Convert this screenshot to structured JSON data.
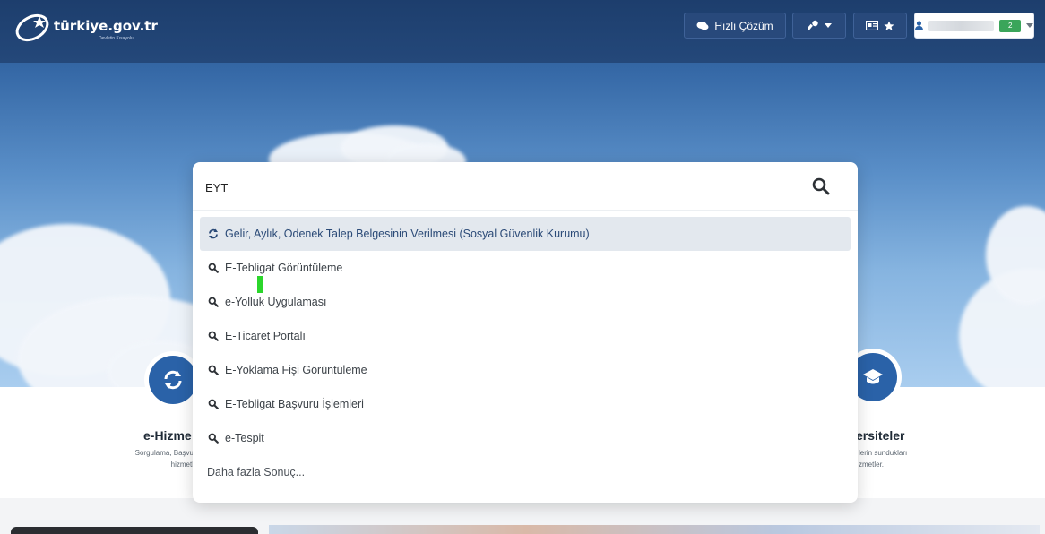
{
  "header": {
    "logo_text": "türkiye.gov.tr",
    "logo_tagline": "Devletin Kısayolu",
    "quick_solution_label": "Hızlı Çözüm",
    "user_badge": "2"
  },
  "search": {
    "value": "EYT",
    "results": [
      {
        "label": "Gelir, Aylık, Ödenek Talep Belgesinin Verilmesi (Sosyal Güvenlik Kurumu)",
        "icon": "refresh-icon",
        "active": true
      },
      {
        "label": "E-Tebligat Görüntüleme",
        "icon": "search-icon"
      },
      {
        "label": "e-Yolluk Uygulaması",
        "icon": "search-icon"
      },
      {
        "label": "E-Ticaret Portalı",
        "icon": "search-icon"
      },
      {
        "label": "E-Yoklama Fişi Görüntüleme",
        "icon": "search-icon"
      },
      {
        "label": "E-Tebligat Başvuru İşlemleri",
        "icon": "search-icon"
      },
      {
        "label": "e-Tespit",
        "icon": "search-icon"
      }
    ],
    "more_label": "Daha fazla Sonuç..."
  },
  "cards": {
    "left": {
      "title": "e-Hizme",
      "desc_line1": "Sorgulama, Başvu",
      "desc_line2": "hizmetl"
    },
    "right": {
      "title": "ersiteler",
      "desc_line1": "lerin sundukları",
      "desc_line2": "zmetler."
    }
  },
  "colors": {
    "topbar": "#1d3e6d",
    "accent": "#2a62a8",
    "active_row": "#e3e8ee",
    "user_badge": "#3aa55a"
  }
}
